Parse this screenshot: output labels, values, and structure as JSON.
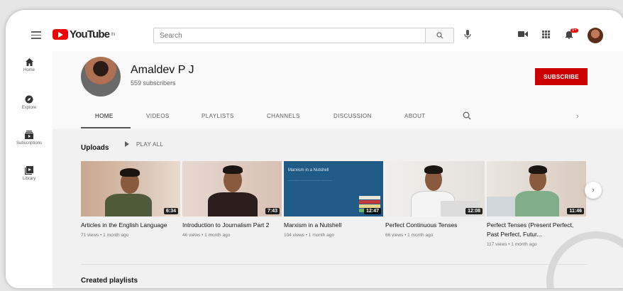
{
  "header": {
    "logo_text": "YouTube",
    "logo_sup": "IN",
    "search_placeholder": "Search",
    "notification_count": "9+"
  },
  "sidebar": {
    "items": [
      {
        "label": "Home",
        "icon": "home-icon"
      },
      {
        "label": "Explore",
        "icon": "compass-icon"
      },
      {
        "label": "Subscriptions",
        "icon": "subscriptions-icon"
      },
      {
        "label": "Library",
        "icon": "library-icon"
      }
    ]
  },
  "channel": {
    "name": "Amaldev P J",
    "subscribers": "559 subscribers",
    "subscribe_label": "SUBSCRIBE"
  },
  "tabs": [
    "HOME",
    "VIDEOS",
    "PLAYLISTS",
    "CHANNELS",
    "DISCUSSION",
    "ABOUT"
  ],
  "uploads": {
    "title": "Uploads",
    "play_all": "PLAY ALL"
  },
  "videos": [
    {
      "title": "Articles in the English Language",
      "meta": "71 views • 1 month ago",
      "duration": "6:34"
    },
    {
      "title": "Introduction to Journalism Part 2",
      "meta": "46 views • 1 month ago",
      "duration": "7:43"
    },
    {
      "title": "Marxism in a Nutshell",
      "meta": "104 views • 1 month ago",
      "duration": "12:47",
      "thumb_title": "Marxism in a Nutshell"
    },
    {
      "title": "Perfect Continuous Tenses",
      "meta": "66 views • 1 month ago",
      "duration": "12:08"
    },
    {
      "title": "Perfect Tenses (Present Perfect, Past Perfect, Futur...",
      "meta": "117 views • 1 month ago",
      "duration": "11:46"
    }
  ],
  "created_playlists": "Created playlists",
  "colors": {
    "brand_red": "#cc0000",
    "background": "#f1f1f1"
  }
}
